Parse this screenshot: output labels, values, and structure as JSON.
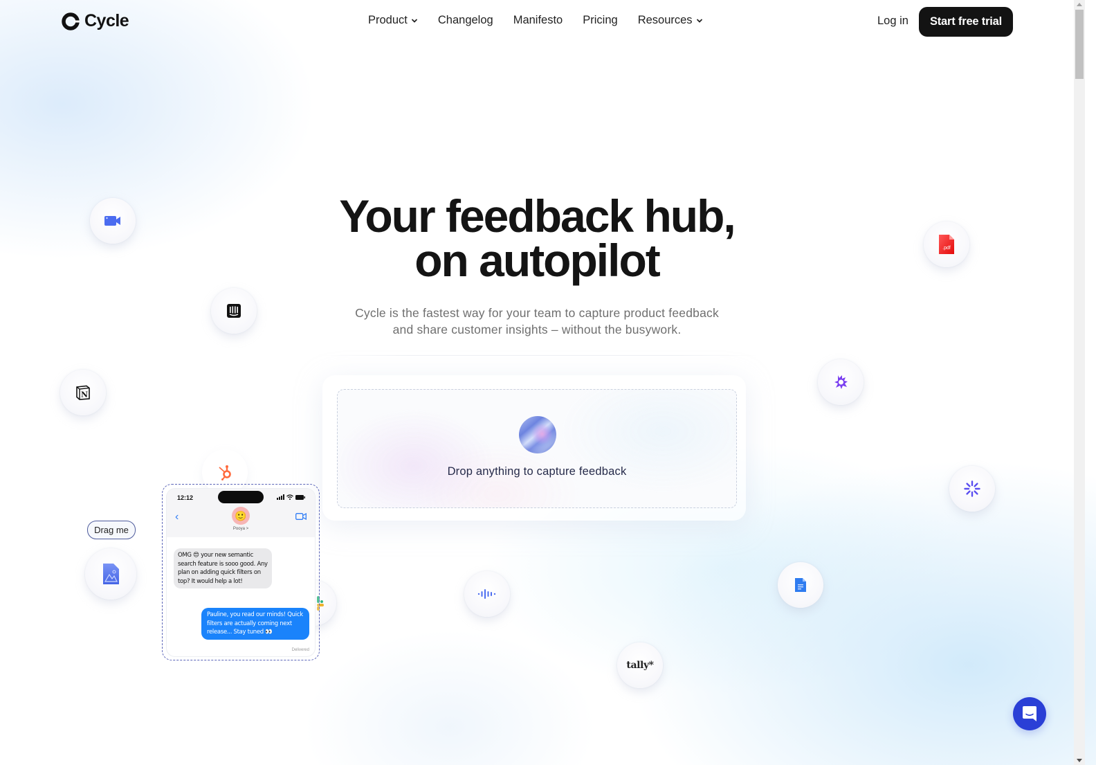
{
  "brand": {
    "name": "Cycle",
    "logo_icon": "cycle-logo-icon"
  },
  "nav": {
    "links": [
      {
        "label": "Product",
        "has_dropdown": true
      },
      {
        "label": "Changelog",
        "has_dropdown": false
      },
      {
        "label": "Manifesto",
        "has_dropdown": false
      },
      {
        "label": "Pricing",
        "has_dropdown": false
      },
      {
        "label": "Resources",
        "has_dropdown": true
      }
    ],
    "login_label": "Log in",
    "cta_label": "Start free trial"
  },
  "hero": {
    "title_line1": "Your feedback hub,",
    "title_line2": "on autopilot",
    "subtitle_line1": "Cycle is the fastest way for your team to capture product feedback",
    "subtitle_line2": "and share customer insights – without the busywork."
  },
  "drop_zone": {
    "text": "Drop anything to capture feedback",
    "icon": "ai-orb-icon"
  },
  "floating_sources": [
    {
      "name": "video-call-icon",
      "color": "#4b6cf0"
    },
    {
      "name": "intercom-icon",
      "color": "#111111"
    },
    {
      "name": "notion-icon",
      "color": "#111111"
    },
    {
      "name": "hubspot-icon",
      "color": "#ff6a3d"
    },
    {
      "name": "image-file-icon",
      "color": "#5677ee"
    },
    {
      "name": "slack-icon",
      "color": "#2eb67d"
    },
    {
      "name": "audio-wave-icon",
      "color": "#4b6cf0"
    },
    {
      "name": "tally-logo",
      "label": "tally*",
      "color": "#222222"
    },
    {
      "name": "google-docs-icon",
      "color": "#2f7cf0"
    },
    {
      "name": "loom-icon",
      "color": "#5b4ff0"
    },
    {
      "name": "gong-icon",
      "color": "#7a3ff0"
    },
    {
      "name": "pdf-file-icon",
      "label": ".pdf",
      "color": "#f02020"
    }
  ],
  "drag_hint": "Drag me",
  "phone": {
    "time": "12:12",
    "contact": "Pooya >",
    "incoming_message": "OMG 😍 your new semantic search feature is sooo good. Any plan on adding quick filters on top? It would help a lot!",
    "outgoing_message": "Pauline, you read our minds! Quick filters are actually coming next release... Stay tuned 👀",
    "status": "Delivered"
  },
  "chat_launcher": {
    "icon": "chat-smile-icon",
    "color": "#2a3fd6"
  }
}
